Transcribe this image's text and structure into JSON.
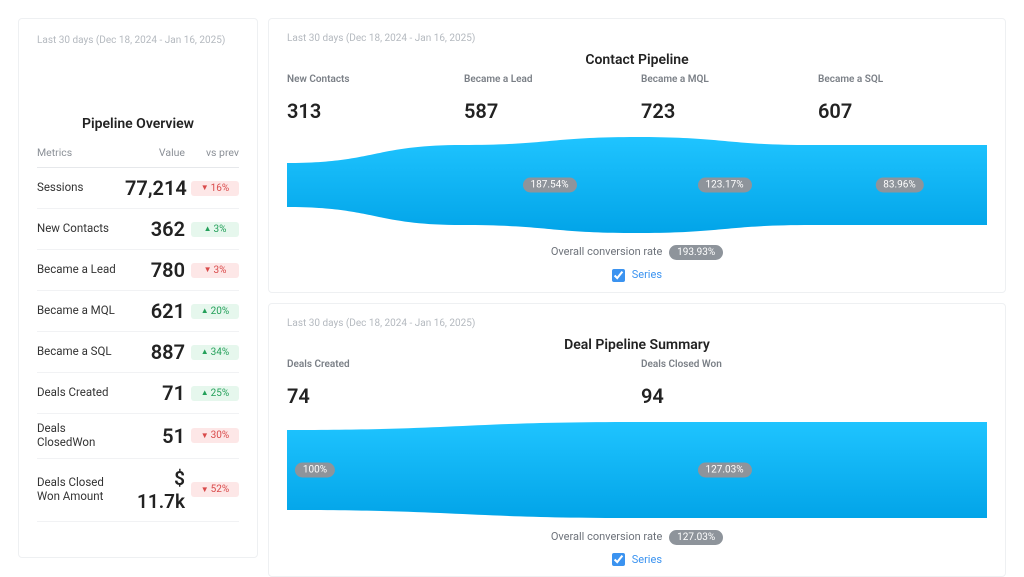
{
  "date_range": "Last 30 days (Dec 18, 2024 - Jan 16, 2025)",
  "sidebar": {
    "title": "Pipeline Overview",
    "headers": {
      "metric": "Metrics",
      "value": "Value",
      "vs_prev": "vs prev"
    },
    "rows": [
      {
        "label": "Sessions",
        "value": "77,214",
        "delta": "16%",
        "dir": "down"
      },
      {
        "label": "New Contacts",
        "value": "362",
        "delta": "3%",
        "dir": "up"
      },
      {
        "label": "Became a Lead",
        "value": "780",
        "delta": "3%",
        "dir": "down"
      },
      {
        "label": "Became a MQL",
        "value": "621",
        "delta": "20%",
        "dir": "up"
      },
      {
        "label": "Became a SQL",
        "value": "887",
        "delta": "34%",
        "dir": "up"
      },
      {
        "label": "Deals Created",
        "value": "71",
        "delta": "25%",
        "dir": "up"
      },
      {
        "label": "Deals ClosedWon",
        "value": "51",
        "delta": "30%",
        "dir": "down"
      },
      {
        "label": "Deals Closed Won Amount",
        "value": "$ 11.7k",
        "delta": "52%",
        "dir": "down",
        "amount": true
      }
    ]
  },
  "contact_panel": {
    "title": "Contact Pipeline",
    "stages": [
      {
        "label": "New Contacts",
        "value": "313"
      },
      {
        "label": "Became a Lead",
        "value": "587"
      },
      {
        "label": "Became a MQL",
        "value": "723"
      },
      {
        "label": "Became a SQL",
        "value": "607"
      }
    ],
    "conversions": [
      "187.54%",
      "123.17%",
      "83.96%"
    ],
    "overall_label": "Overall conversion rate",
    "overall": "193.93%",
    "legend": "Series"
  },
  "deal_panel": {
    "title": "Deal Pipeline Summary",
    "stages": [
      {
        "label": "Deals Created",
        "value": "74"
      },
      {
        "label": "Deals Closed Won",
        "value": "94"
      }
    ],
    "conversions": [
      "100%",
      "127.03%"
    ],
    "overall_label": "Overall conversion rate",
    "overall": "127.03%",
    "legend": "Series"
  },
  "chart_data": [
    {
      "type": "bar",
      "title": "Contact Pipeline",
      "categories": [
        "New Contacts",
        "Became a Lead",
        "Became a MQL",
        "Became a SQL"
      ],
      "values": [
        313,
        587,
        723,
        607
      ],
      "stage_conversion_pct": [
        187.54,
        123.17,
        83.96
      ],
      "overall_conversion_pct": 193.93
    },
    {
      "type": "bar",
      "title": "Deal Pipeline Summary",
      "categories": [
        "Deals Created",
        "Deals Closed Won"
      ],
      "values": [
        74,
        94
      ],
      "stage_conversion_pct": [
        127.03
      ],
      "overall_conversion_pct": 127.03
    }
  ]
}
